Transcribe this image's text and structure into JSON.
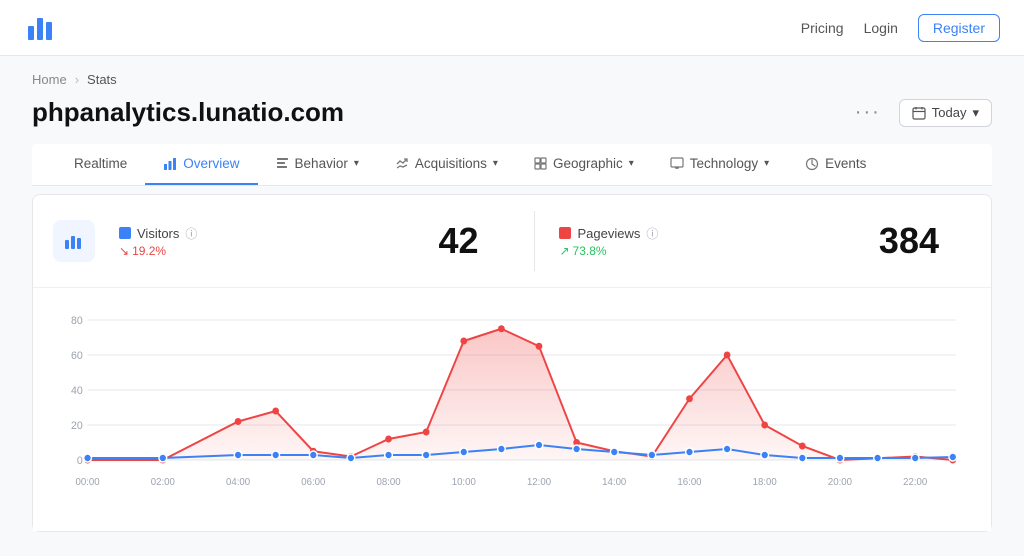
{
  "header": {
    "nav": {
      "pricing": "Pricing",
      "login": "Login",
      "register": "Register"
    }
  },
  "breadcrumb": {
    "home": "Home",
    "current": "Stats"
  },
  "page": {
    "title": "phpanalytics.lunatio.com",
    "more_label": "···",
    "date_label": "Today"
  },
  "tabs": [
    {
      "id": "realtime",
      "label": "Realtime",
      "icon": "",
      "active": false
    },
    {
      "id": "overview",
      "label": "Overview",
      "icon": "📊",
      "active": true
    },
    {
      "id": "behavior",
      "label": "Behavior",
      "icon": "📋",
      "active": false,
      "dropdown": true
    },
    {
      "id": "acquisitions",
      "label": "Acquisitions",
      "icon": "🔀",
      "active": false,
      "dropdown": true
    },
    {
      "id": "geographic",
      "label": "Geographic",
      "icon": "📍",
      "active": false,
      "dropdown": true
    },
    {
      "id": "technology",
      "label": "Technology",
      "icon": "💻",
      "active": false,
      "dropdown": true
    },
    {
      "id": "events",
      "label": "Events",
      "icon": "⟳",
      "active": false
    }
  ],
  "stats": {
    "visitors": {
      "label": "Visitors",
      "value": "42",
      "change": "19.2%",
      "change_dir": "down",
      "color": "#3b82f6"
    },
    "pageviews": {
      "label": "Pageviews",
      "value": "384",
      "change": "73.8%",
      "change_dir": "up",
      "color": "#ef4444"
    }
  },
  "chart": {
    "y_labels": [
      "80",
      "60",
      "40",
      "20",
      "0"
    ],
    "x_labels": [
      "00:00",
      "02:00",
      "04:00",
      "06:00",
      "08:00",
      "10:00",
      "12:00",
      "14:00",
      "16:00",
      "18:00",
      "20:00",
      "22:00"
    ],
    "pageviews_points": [
      [
        0,
        0
      ],
      [
        2,
        0
      ],
      [
        4,
        22
      ],
      [
        5,
        28
      ],
      [
        6,
        5
      ],
      [
        7,
        2
      ],
      [
        8,
        12
      ],
      [
        9,
        16
      ],
      [
        10,
        68
      ],
      [
        11,
        75
      ],
      [
        12,
        65
      ],
      [
        13,
        10
      ],
      [
        14,
        5
      ],
      [
        15,
        2
      ],
      [
        16,
        35
      ],
      [
        17,
        60
      ],
      [
        18,
        20
      ],
      [
        19,
        8
      ],
      [
        20,
        0
      ],
      [
        21,
        1
      ],
      [
        22,
        2
      ],
      [
        23,
        0
      ]
    ],
    "visitors_points": [
      [
        0,
        1
      ],
      [
        2,
        1
      ],
      [
        4,
        2
      ],
      [
        5,
        2
      ],
      [
        6,
        2
      ],
      [
        7,
        1
      ],
      [
        8,
        2
      ],
      [
        9,
        2
      ],
      [
        10,
        3
      ],
      [
        11,
        4
      ],
      [
        12,
        5
      ],
      [
        13,
        4
      ],
      [
        14,
        3
      ],
      [
        15,
        2
      ],
      [
        16,
        3
      ],
      [
        17,
        4
      ],
      [
        18,
        2
      ],
      [
        19,
        1
      ],
      [
        20,
        1
      ],
      [
        21,
        1
      ],
      [
        22,
        1
      ],
      [
        23,
        1
      ]
    ]
  }
}
